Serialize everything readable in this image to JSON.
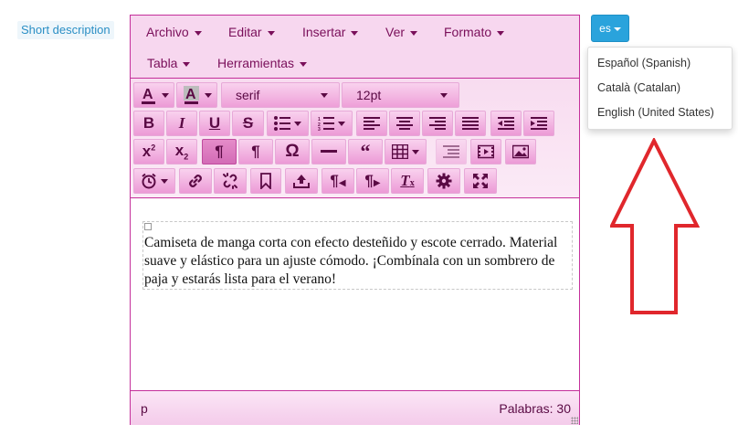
{
  "field": {
    "label": "Short description"
  },
  "menubar": {
    "items": [
      {
        "label": "Archivo"
      },
      {
        "label": "Editar"
      },
      {
        "label": "Insertar"
      },
      {
        "label": "Ver"
      },
      {
        "label": "Formato"
      },
      {
        "label": "Tabla"
      },
      {
        "label": "Herramientas"
      }
    ]
  },
  "toolbar": {
    "font_family": "serif",
    "font_size": "12pt",
    "icons": {
      "row1": [
        "text-color-icon",
        "background-color-icon"
      ],
      "row2": [
        "bold-icon",
        "italic-icon",
        "underline-icon",
        "strikethrough-icon",
        "bullet-list-icon",
        "numbered-list-icon",
        "align-left-icon",
        "align-center-icon",
        "align-right-icon",
        "align-justify-icon",
        "outdent-icon",
        "indent-icon"
      ],
      "row3": [
        "superscript-icon",
        "subscript-icon",
        "paragraph-mark-icon",
        "paragraph-mark-icon",
        "omega-icon",
        "horizontal-rule-icon",
        "blockquote-icon",
        "table-icon",
        "list-icon",
        "media-icon",
        "image-icon"
      ],
      "row4": [
        "alarm-clock-icon",
        "link-icon",
        "unlink-icon",
        "bookmark-icon",
        "upload-icon",
        "ltr-icon",
        "rtl-icon",
        "clear-formatting-icon",
        "gear-icon",
        "fullscreen-icon"
      ]
    }
  },
  "content": {
    "paragraph": "Camiseta de manga corta con efecto desteñido y escote cerrado. Material suave y elástico para un ajuste cómodo. ¡Combínala con un sombrero de paja y estarás lista para el verano!"
  },
  "statusbar": {
    "path": "p",
    "words": "Palabras: 30"
  },
  "language": {
    "current": "es",
    "options": [
      "Español (Spanish)",
      "Català (Catalan)",
      "English (United States)"
    ]
  },
  "colors": {
    "accent": "#c42f9a",
    "menubar_bg": "#f7d7ef",
    "button_gradient_bottom": "#ec9ad6",
    "language_button": "#2aa3dc",
    "arrow": "#e0272c"
  }
}
